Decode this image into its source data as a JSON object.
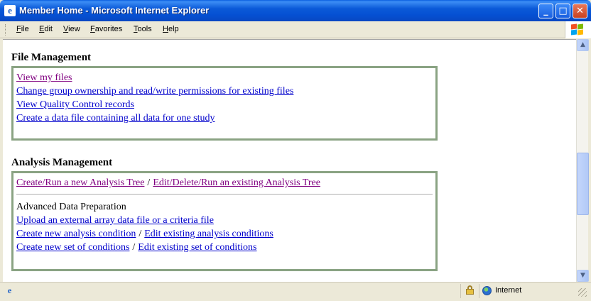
{
  "window": {
    "title": "Member Home - Microsoft Internet Explorer",
    "icon": "ie-icon",
    "controls": [
      "minimize",
      "maximize",
      "close"
    ]
  },
  "menubar": {
    "items": [
      {
        "label": "File"
      },
      {
        "label": "Edit"
      },
      {
        "label": "View"
      },
      {
        "label": "Favorites"
      },
      {
        "label": "Tools"
      },
      {
        "label": "Help"
      }
    ]
  },
  "file_management": {
    "title": "File Management",
    "links": [
      {
        "label": "View my files",
        "visited": true
      },
      {
        "label": "Change group ownership and read/write permissions for existing files",
        "visited": false
      },
      {
        "label": "View Quality Control records",
        "visited": false
      },
      {
        "label": "Create a data file containing all data for one study",
        "visited": false
      }
    ]
  },
  "analysis_management": {
    "title": "Analysis Management",
    "tree_links": [
      {
        "label": "Create/Run a new Analysis Tree",
        "visited": true
      },
      {
        "label": "Edit/Delete/Run an existing Analysis Tree",
        "visited": true
      }
    ],
    "separator": "/",
    "advanced_heading": "Advanced Data Preparation",
    "upload_link": "Upload an external array data file or a criteria file",
    "condition_links": [
      {
        "label": "Create new analysis condition"
      },
      {
        "label": "Edit existing analysis conditions"
      }
    ],
    "set_links": [
      {
        "label": "Create new set of conditions"
      },
      {
        "label": "Edit existing set of conditions"
      }
    ]
  },
  "statusbar": {
    "zone": "Internet"
  },
  "colors": {
    "link": "#0000cc",
    "visited": "#800080",
    "box_border": "#8aa383",
    "titlebar": "#0550d3"
  }
}
